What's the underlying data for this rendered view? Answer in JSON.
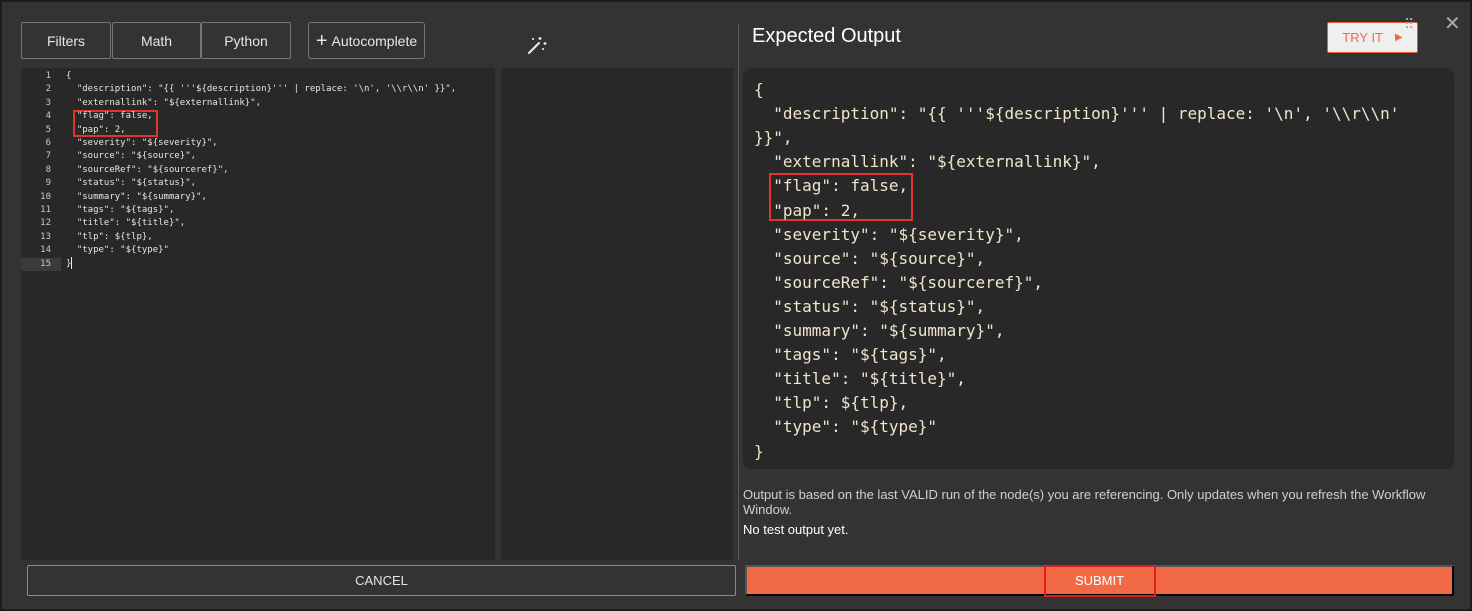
{
  "toolbar": {
    "filters_label": "Filters",
    "math_label": "Math",
    "python_label": "Python",
    "autocomplete_label": "Autocomplete",
    "magic_icon": "magic-wand-icon"
  },
  "editor": {
    "lines": [
      {
        "n": "1",
        "text": "{"
      },
      {
        "n": "2",
        "text": "  \"description\": \"{{ '''${description}''' | replace: '\\n', '\\\\r\\\\n' }}\","
      },
      {
        "n": "3",
        "text": "  \"externallink\": \"${externallink}\","
      },
      {
        "n": "4",
        "text": "  \"flag\": false,"
      },
      {
        "n": "5",
        "text": "  \"pap\": 2,"
      },
      {
        "n": "6",
        "text": "  \"severity\": \"${severity}\","
      },
      {
        "n": "7",
        "text": "  \"source\": \"${source}\","
      },
      {
        "n": "8",
        "text": "  \"sourceRef\": \"${sourceref}\","
      },
      {
        "n": "9",
        "text": "  \"status\": \"${status}\","
      },
      {
        "n": "10",
        "text": "  \"summary\": \"${summary}\","
      },
      {
        "n": "11",
        "text": "  \"tags\": \"${tags}\","
      },
      {
        "n": "12",
        "text": "  \"title\": \"${title}\","
      },
      {
        "n": "13",
        "text": "  \"tlp\": ${tlp},"
      },
      {
        "n": "14",
        "text": "  \"type\": \"${type}\""
      },
      {
        "n": "15",
        "text": "}"
      }
    ]
  },
  "output": {
    "title": "Expected Output",
    "try_label": "TRY IT",
    "lines": [
      "{",
      "  \"description\": \"{{ '''${description}''' | replace: '\\n', '\\\\r\\\\n'",
      "}}\",",
      "  \"externallink\": \"${externallink}\",",
      "  \"flag\": false,",
      "  \"pap\": 2,",
      "  \"severity\": \"${severity}\",",
      "  \"source\": \"${source}\",",
      "  \"sourceRef\": \"${sourceref}\",",
      "  \"status\": \"${status}\",",
      "  \"summary\": \"${summary}\",",
      "  \"tags\": \"${tags}\",",
      "  \"title\": \"${title}\",",
      "  \"tlp\": ${tlp},",
      "  \"type\": \"${type}\"",
      "}"
    ],
    "note": "Output is based on the last VALID run of the node(s) you are referencing. Only updates when you refresh the Workflow Window.",
    "no_output": "No test output yet."
  },
  "footer": {
    "cancel_label": "CANCEL",
    "submit_label": "SUBMIT"
  },
  "colors": {
    "accent": "#f26a45",
    "highlight_border": "#e23232",
    "background": "#333333",
    "editor_bg": "#282828"
  }
}
